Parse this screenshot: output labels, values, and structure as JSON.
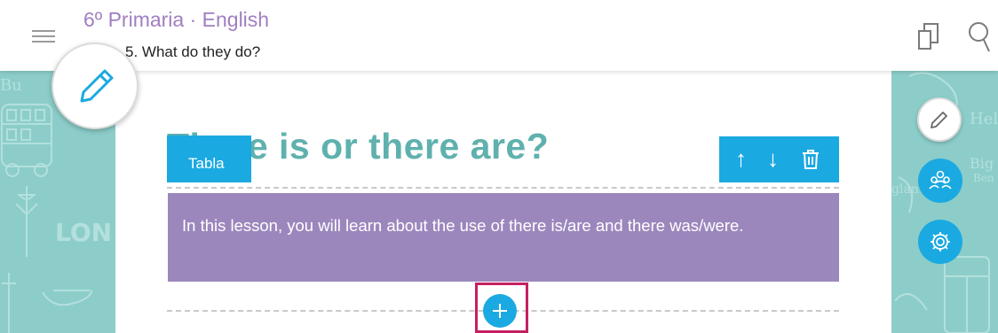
{
  "header": {
    "title": "6º Primaria · English",
    "subtitle": "5. What do they do?"
  },
  "content": {
    "lesson_title": "There is or there are?",
    "tag_label": "Tabla",
    "intro_text": "In this lesson, you will learn about the use of there is/are and there was/were.",
    "tools": {
      "up": "↑",
      "down": "↓",
      "delete": "🗑"
    }
  },
  "icons": {
    "menu": "menu-icon",
    "pages": "pages-icon",
    "search": "search-icon",
    "edit": "pencil-icon",
    "users": "users-icon",
    "settings": "gear-icon",
    "add": "plus-icon"
  },
  "colors": {
    "accent_blue": "#1ba9e1",
    "title_purple": "#a07fc0",
    "lesson_teal": "#5fb1ae",
    "intro_purple": "#9c87bd",
    "side_teal": "#8ccdc9",
    "highlight": "#c52060"
  }
}
